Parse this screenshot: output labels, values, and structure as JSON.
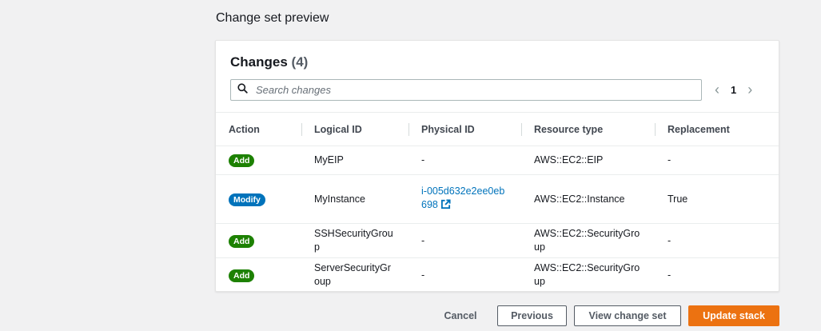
{
  "section_title": "Change set preview",
  "changes": {
    "title": "Changes",
    "count": "(4)",
    "search_placeholder": "Search changes",
    "pagination": {
      "current_page": "1",
      "prev": "‹",
      "next": "›"
    },
    "columns": [
      "Action",
      "Logical ID",
      "Physical ID",
      "Resource type",
      "Replacement"
    ],
    "rows": [
      {
        "action": "Add",
        "action_color": "#1d8102",
        "logical_id": "MyEIP",
        "physical_id": "-",
        "physical_is_link": false,
        "resource_type": "AWS::EC2::EIP",
        "replacement": "-"
      },
      {
        "action": "Modify",
        "action_color": "#0073bb",
        "logical_id": "MyInstance",
        "physical_id": "i-005d632e2ee0eb698",
        "physical_is_link": true,
        "resource_type": "AWS::EC2::Instance",
        "replacement": "True"
      },
      {
        "action": "Add",
        "action_color": "#1d8102",
        "logical_id": "SSHSecurityGroup",
        "physical_id": "-",
        "physical_is_link": false,
        "resource_type": "AWS::EC2::SecurityGroup",
        "replacement": "-"
      },
      {
        "action": "Add",
        "action_color": "#1d8102",
        "logical_id": "ServerSecurityGroup",
        "physical_id": "-",
        "physical_is_link": false,
        "resource_type": "AWS::EC2::SecurityGroup",
        "replacement": "-"
      }
    ]
  },
  "footer": {
    "cancel_label": "Cancel",
    "previous_label": "Previous",
    "view_change_set_label": "View change set",
    "update_stack_label": "Update stack"
  },
  "colors": {
    "primary": "#ec7211",
    "link": "#0073bb",
    "add_badge": "#1d8102",
    "modify_badge": "#0073bb"
  }
}
